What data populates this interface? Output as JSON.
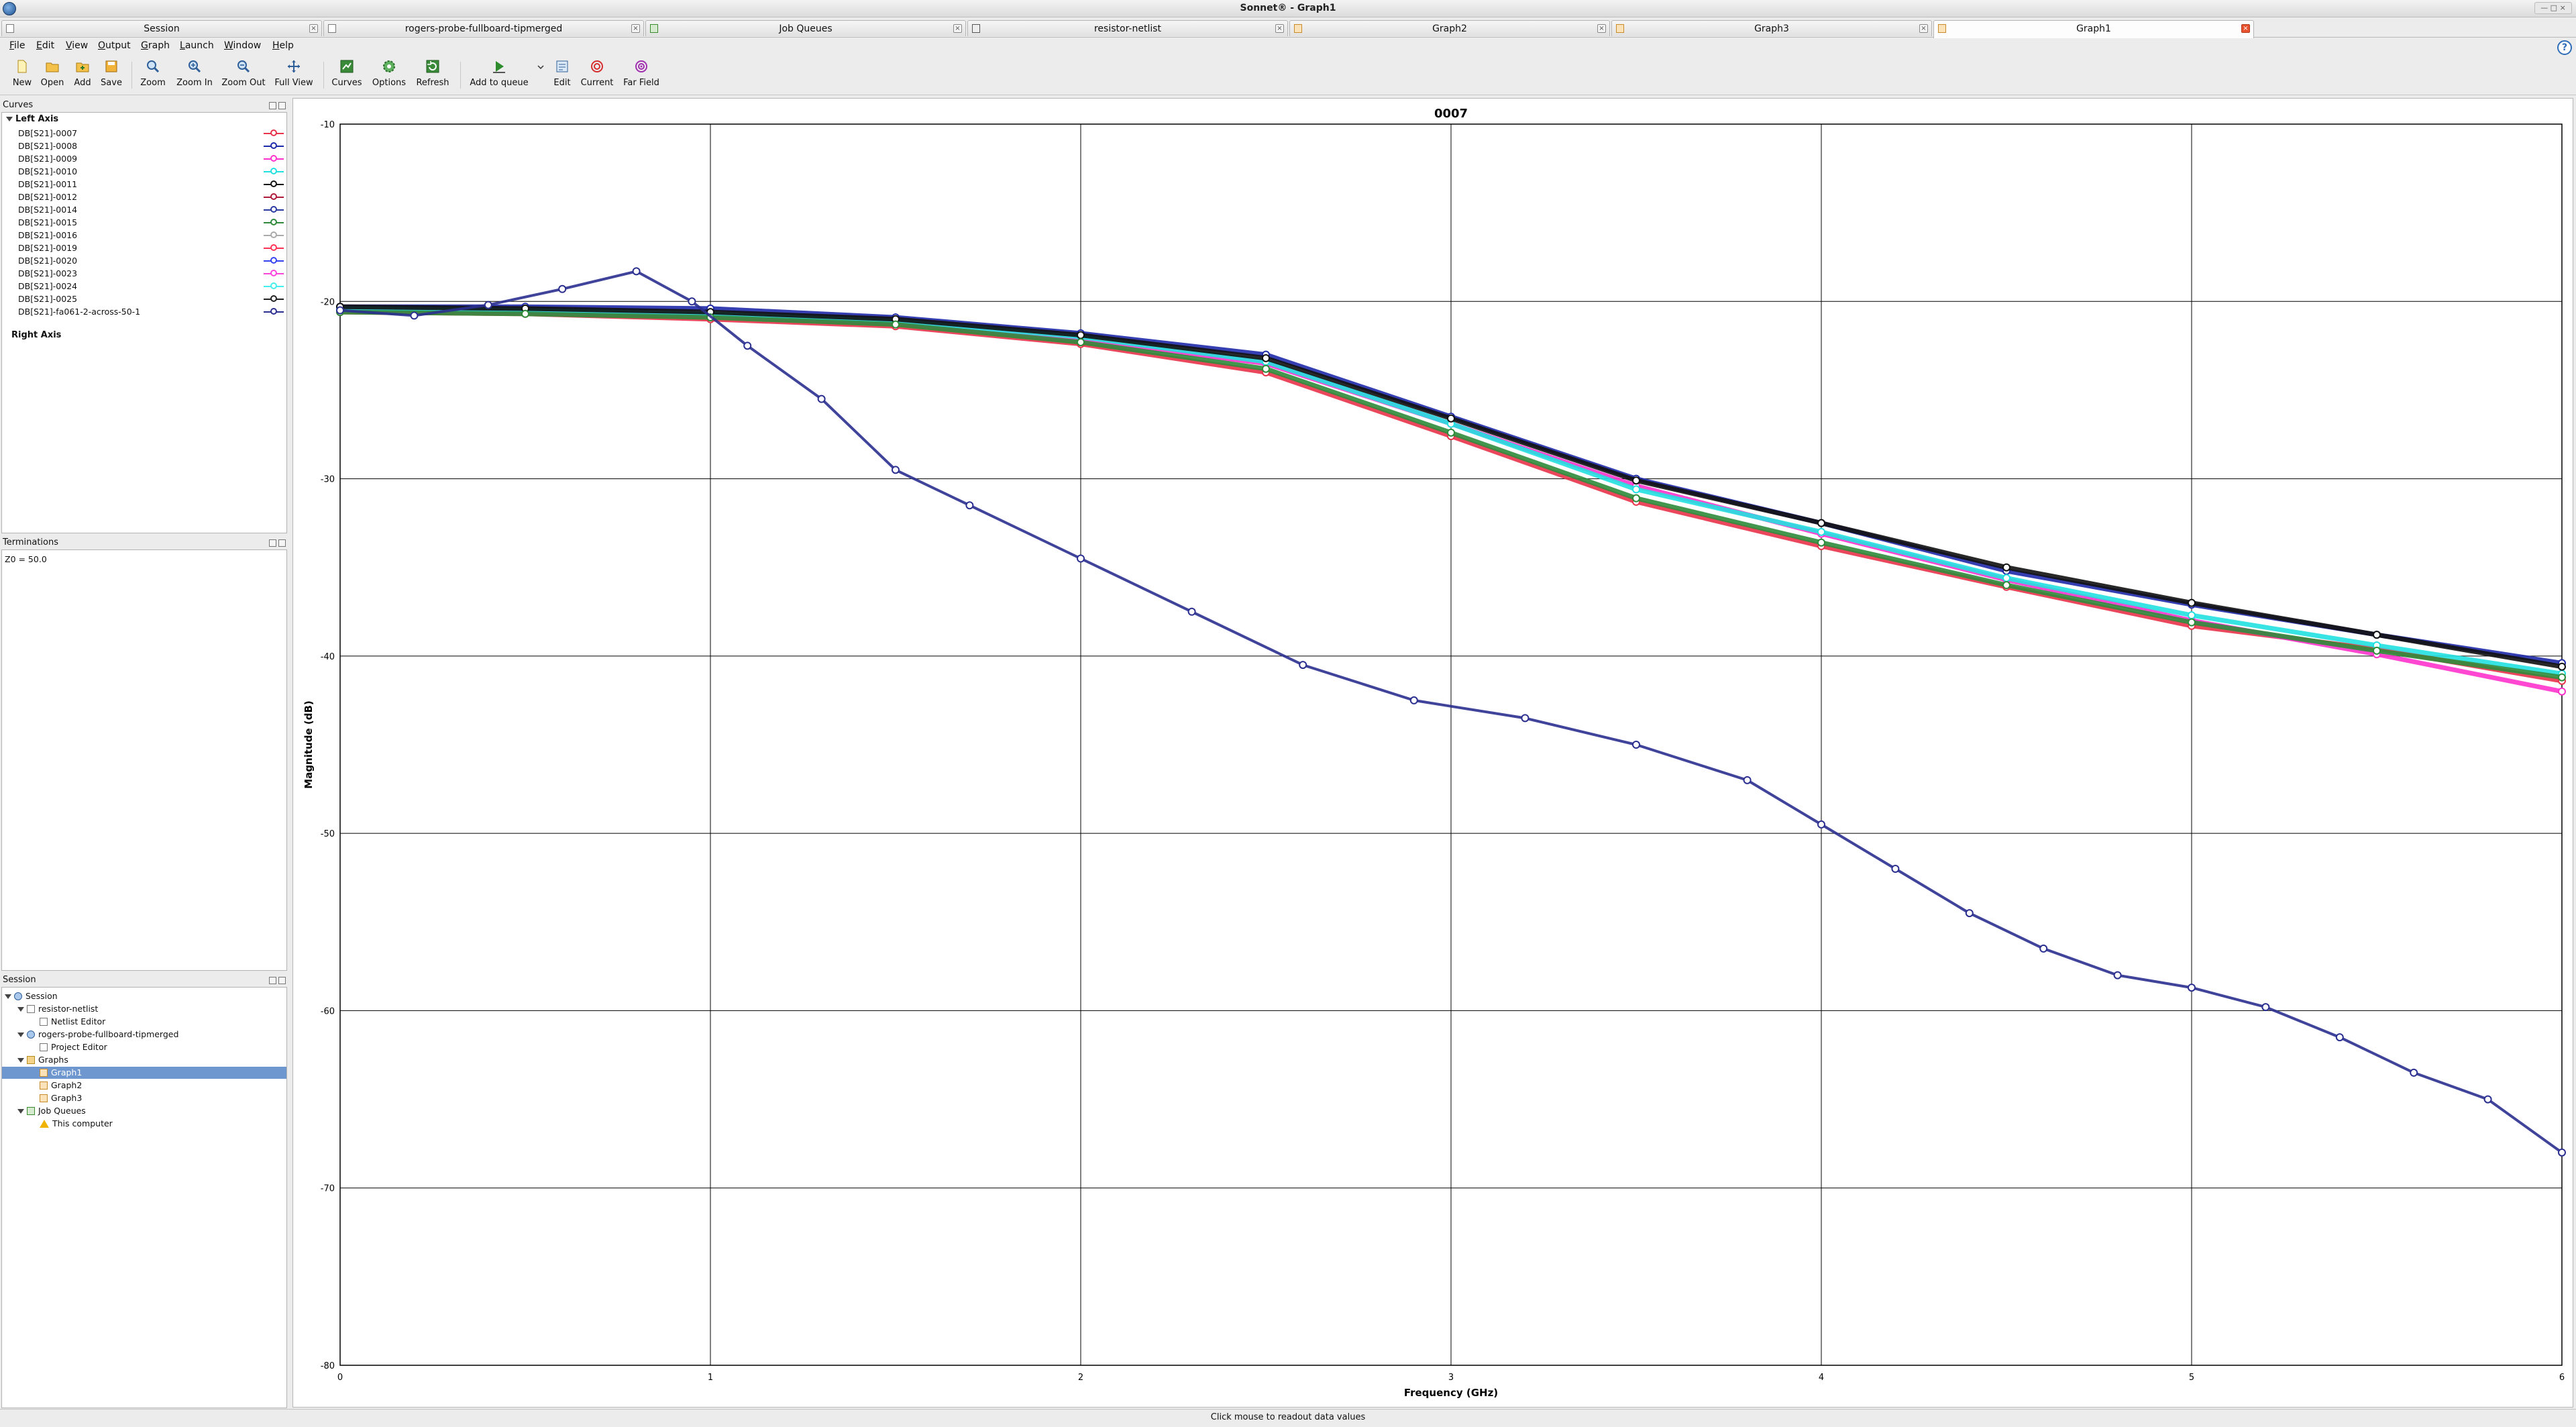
{
  "window": {
    "title": "Sonnet® - Graph1",
    "win_controls": "— □ ×"
  },
  "tabs": [
    {
      "label": "Session",
      "icon": "session"
    },
    {
      "label": "rogers-probe-fullboard-tipmerged",
      "icon": "project"
    },
    {
      "label": "Job Queues",
      "icon": "queue"
    },
    {
      "label": "resistor-netlist",
      "icon": "net"
    },
    {
      "label": "Graph2",
      "icon": "graph"
    },
    {
      "label": "Graph3",
      "icon": "graph"
    },
    {
      "label": "Graph1",
      "icon": "graph",
      "active": true
    }
  ],
  "menu": [
    "File",
    "Edit",
    "View",
    "Output",
    "Graph",
    "Launch",
    "Window",
    "Help"
  ],
  "toolbar": {
    "new": "New",
    "open": "Open",
    "add": "Add",
    "save": "Save",
    "zoom": "Zoom",
    "zoom_in": "Zoom In",
    "zoom_out": "Zoom Out",
    "full_view": "Full View",
    "curves": "Curves",
    "options": "Options",
    "refresh": "Refresh",
    "add_to_queue": "Add to queue",
    "edit": "Edit",
    "current": "Current",
    "far_field": "Far Field"
  },
  "curves_panel": {
    "title": "Curves",
    "left_axis": "Left Axis",
    "right_axis": "Right Axis",
    "items": [
      {
        "label": "DB[S21]-0007",
        "color": "#e8334a"
      },
      {
        "label": "DB[S21]-0008",
        "color": "#1f2aa8"
      },
      {
        "label": "DB[S21]-0009",
        "color": "#ff33cc"
      },
      {
        "label": "DB[S21]-0010",
        "color": "#22e0e0"
      },
      {
        "label": "DB[S21]-0011",
        "color": "#111111"
      },
      {
        "label": "DB[S21]-0012",
        "color": "#b01a3a"
      },
      {
        "label": "DB[S21]-0014",
        "color": "#2a3aa0"
      },
      {
        "label": "DB[S21]-0015",
        "color": "#2e8b3a"
      },
      {
        "label": "DB[S21]-0016",
        "color": "#aaaaaa"
      },
      {
        "label": "DB[S21]-0019",
        "color": "#ff3355"
      },
      {
        "label": "DB[S21]-0020",
        "color": "#3344ee"
      },
      {
        "label": "DB[S21]-0023",
        "color": "#ff44dd"
      },
      {
        "label": "DB[S21]-0024",
        "color": "#44eeee"
      },
      {
        "label": "DB[S21]-0025",
        "color": "#222222"
      },
      {
        "label": "DB[S21]-fa061-2-across-50-1",
        "color": "#2b2f8f"
      }
    ]
  },
  "terminations_panel": {
    "title": "Terminations",
    "text": "Z0 = 50.0"
  },
  "session_panel": {
    "title": "Session",
    "tree": [
      {
        "label": "Session",
        "indent": 0,
        "icon": "session",
        "expanded": true
      },
      {
        "label": "resistor-netlist",
        "indent": 1,
        "icon": "net",
        "expanded": true
      },
      {
        "label": "Netlist Editor",
        "indent": 2,
        "icon": "net"
      },
      {
        "label": "rogers-probe-fullboard-tipmerged",
        "indent": 1,
        "icon": "session",
        "expanded": true
      },
      {
        "label": "Project Editor",
        "indent": 2,
        "icon": "net"
      },
      {
        "label": "Graphs",
        "indent": 1,
        "icon": "folder",
        "expanded": true
      },
      {
        "label": "Graph1",
        "indent": 2,
        "icon": "graph",
        "selected": true
      },
      {
        "label": "Graph2",
        "indent": 2,
        "icon": "graph"
      },
      {
        "label": "Graph3",
        "indent": 2,
        "icon": "graph"
      },
      {
        "label": "Job Queues",
        "indent": 1,
        "icon": "queue",
        "expanded": true
      },
      {
        "label": "This computer",
        "indent": 2,
        "icon": "warn"
      }
    ]
  },
  "status": "Click mouse to readout data values",
  "chart_data": {
    "type": "line",
    "title": "0007",
    "xlabel": "Frequency (GHz)",
    "ylabel": "Magnitude (dB)",
    "xlim": [
      0,
      6
    ],
    "ylim": [
      -80,
      -10
    ],
    "xticks": [
      0,
      1,
      2,
      3,
      4,
      5,
      6
    ],
    "yticks": [
      -10,
      -20,
      -30,
      -40,
      -50,
      -60,
      -70,
      -80
    ],
    "grid": true,
    "series": [
      {
        "name": "DB[S21]-0007",
        "color": "#e8334a",
        "x": [
          0,
          0.5,
          1,
          1.5,
          2,
          2.5,
          3,
          3.5,
          4,
          4.5,
          5,
          5.5,
          6
        ],
        "y": [
          -20.6,
          -20.7,
          -21.0,
          -21.4,
          -22.4,
          -24.0,
          -27.6,
          -31.3,
          -33.8,
          -36.1,
          -38.3,
          -39.6,
          -41.4
        ]
      },
      {
        "name": "DB[S21]-0008",
        "color": "#1f2aa8",
        "x": [
          0,
          0.5,
          1,
          1.5,
          2,
          2.5,
          3,
          3.5,
          4,
          4.5,
          5,
          5.5,
          6
        ],
        "y": [
          -20.3,
          -20.3,
          -20.4,
          -20.9,
          -21.8,
          -23.0,
          -26.5,
          -30.0,
          -32.5,
          -35.2,
          -37.1,
          -38.8,
          -40.4
        ]
      },
      {
        "name": "DB[S21]-0009",
        "color": "#ff33cc",
        "x": [
          0,
          0.5,
          1,
          1.5,
          2,
          2.5,
          3,
          3.5,
          4,
          4.5,
          5,
          5.5,
          6
        ],
        "y": [
          -20.5,
          -20.6,
          -20.8,
          -21.2,
          -22.2,
          -23.5,
          -26.9,
          -30.4,
          -33.1,
          -35.7,
          -38.0,
          -39.9,
          -42.0
        ]
      },
      {
        "name": "DB[S21]-0010",
        "color": "#22e0e0",
        "x": [
          0,
          0.5,
          1,
          1.5,
          2,
          2.5,
          3,
          3.5,
          4,
          4.5,
          5,
          5.5,
          6
        ],
        "y": [
          -20.4,
          -20.5,
          -20.7,
          -21.1,
          -22.0,
          -23.4,
          -26.9,
          -30.6,
          -33.0,
          -35.6,
          -37.7,
          -39.4,
          -41.0
        ]
      },
      {
        "name": "DB[S21]-0011",
        "color": "#111111",
        "x": [
          0,
          0.5,
          1,
          1.5,
          2,
          2.5,
          3,
          3.5,
          4,
          4.5,
          5,
          5.5,
          6
        ],
        "y": [
          -20.3,
          -20.4,
          -20.6,
          -21.0,
          -21.9,
          -23.2,
          -26.6,
          -30.1,
          -32.5,
          -35.0,
          -37.0,
          -38.8,
          -40.6
        ]
      },
      {
        "name": "DB[S21]-0015",
        "color": "#2e8b3a",
        "x": [
          0,
          0.5,
          1,
          1.5,
          2,
          2.5,
          3,
          3.5,
          4,
          4.5,
          5,
          5.5,
          6
        ],
        "y": [
          -20.6,
          -20.7,
          -20.9,
          -21.3,
          -22.3,
          -23.8,
          -27.4,
          -31.1,
          -33.6,
          -36.0,
          -38.1,
          -39.7,
          -41.2
        ]
      },
      {
        "name": "DB[S21]-fa061-2-across-50-1",
        "color": "#2b2f8f",
        "x": [
          0,
          0.2,
          0.4,
          0.6,
          0.8,
          0.95,
          1.1,
          1.3,
          1.5,
          1.7,
          2.0,
          2.3,
          2.6,
          2.9,
          3.2,
          3.5,
          3.8,
          4.0,
          4.2,
          4.4,
          4.6,
          4.8,
          5.0,
          5.2,
          5.4,
          5.6,
          5.8,
          6.0
        ],
        "y": [
          -20.5,
          -20.8,
          -20.2,
          -19.3,
          -18.3,
          -20.0,
          -22.5,
          -25.5,
          -29.5,
          -31.5,
          -34.5,
          -37.5,
          -40.5,
          -42.5,
          -43.5,
          -45.0,
          -47.0,
          -49.5,
          -52.0,
          -54.5,
          -56.5,
          -58.0,
          -58.7,
          -59.8,
          -61.5,
          -63.5,
          -65.0,
          -68.0
        ]
      }
    ]
  }
}
